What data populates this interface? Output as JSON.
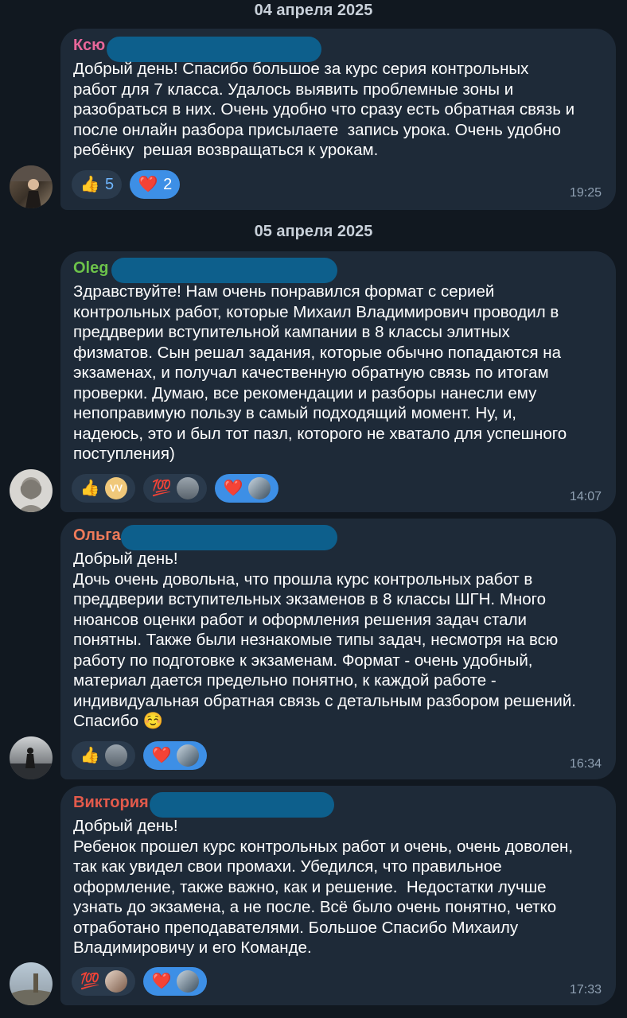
{
  "dates": [
    "04 апреля 2025",
    "05 апреля 2025"
  ],
  "colors": {
    "background": "#111820",
    "bubble": "#1e2a38",
    "name_pink": "#e8679a",
    "name_green": "#6cc24a",
    "name_orange": "#ef7b5a",
    "name_red": "#e35a4b",
    "reaction_active": "#3d8fe6",
    "redaction": "#0d5f8c"
  },
  "messages": [
    {
      "sender": "Ксю",
      "text": "Добрый день! Спасибо большое за курс серия контрольных\nработ для 7 класса. Удалось выявить проблемные зоны и\nразобраться в них. Очень удобно что сразу есть обратная связь и\nпосле онлайн разбора присылаете  запись урока. Очень удобно\nребёнку  решая возвращаться к урокам.",
      "time": "19:25",
      "reactions": [
        {
          "emoji": "thumbs-up-icon",
          "glyph": "👍",
          "count": "5",
          "active": false
        },
        {
          "emoji": "red-heart-icon",
          "glyph": "❤️",
          "count": "2",
          "active": true
        }
      ]
    },
    {
      "sender": "Oleg",
      "text": "Здравствуйте! Нам очень понравился формат с серией\nконтрольных работ, которые Михаил Владимирович проводил в\nпреддверии вступительной кампании в 8 классы элитных\nфизматов. Сын решал задания, которые обычно попадаются на\nэкзаменах, и получал качественную обратную связь по итогам\nпроверки. Думаю, все рекомендации и разборы нанесли ему\nнепоправимую пользу в самый подходящий момент. Ну, и,\nнадеюсь, это и был тот пазл, которого не хватало для успешного\nпоступления)",
      "time": "14:07",
      "reactions": [
        {
          "emoji": "thumbs-up-icon",
          "glyph": "👍",
          "reactor": "VV",
          "active": false
        },
        {
          "emoji": "hundred-points-icon",
          "glyph": "💯",
          "active": false
        },
        {
          "emoji": "red-heart-icon",
          "glyph": "❤️",
          "active": true
        }
      ]
    },
    {
      "sender": "Ольга",
      "text": "Добрый день!\nДочь очень довольна, что прошла курс контрольных работ в\nпреддверии вступительных экзаменов в 8 классы ШГН. Много\nнюансов оценки работ и оформления решения задач стали\nпонятны. Также были незнакомые типы задач, несмотря на всю\nработу по подготовке к экзаменам. Формат - очень удобный,\nматериал дается предельно понятно, к каждой работе -\nиндивидуальная обратная связь с детальным разбором решений.\nСпасибо ☺️",
      "time": "16:34",
      "reactions": [
        {
          "emoji": "thumbs-up-icon",
          "glyph": "👍",
          "active": false
        },
        {
          "emoji": "red-heart-icon",
          "glyph": "❤️",
          "active": true
        }
      ]
    },
    {
      "sender": "Виктория",
      "text": "Добрый день!\nРебенок прошел курс контрольных работ и очень, очень доволен,\nтак как увидел свои промахи. Убедился, что правильное\nоформление, также важно, как и решение.  Недостатки лучше\nузнать до экзамена, а не после. Всё было очень понятно, четко\nотработано преподавателями. Большое Спасибо Михаилу\nВладимировичу и его Команде.",
      "time": "17:33",
      "reactions": [
        {
          "emoji": "hundred-points-icon",
          "glyph": "💯",
          "active": false
        },
        {
          "emoji": "red-heart-icon",
          "glyph": "❤️",
          "active": true
        }
      ]
    }
  ]
}
